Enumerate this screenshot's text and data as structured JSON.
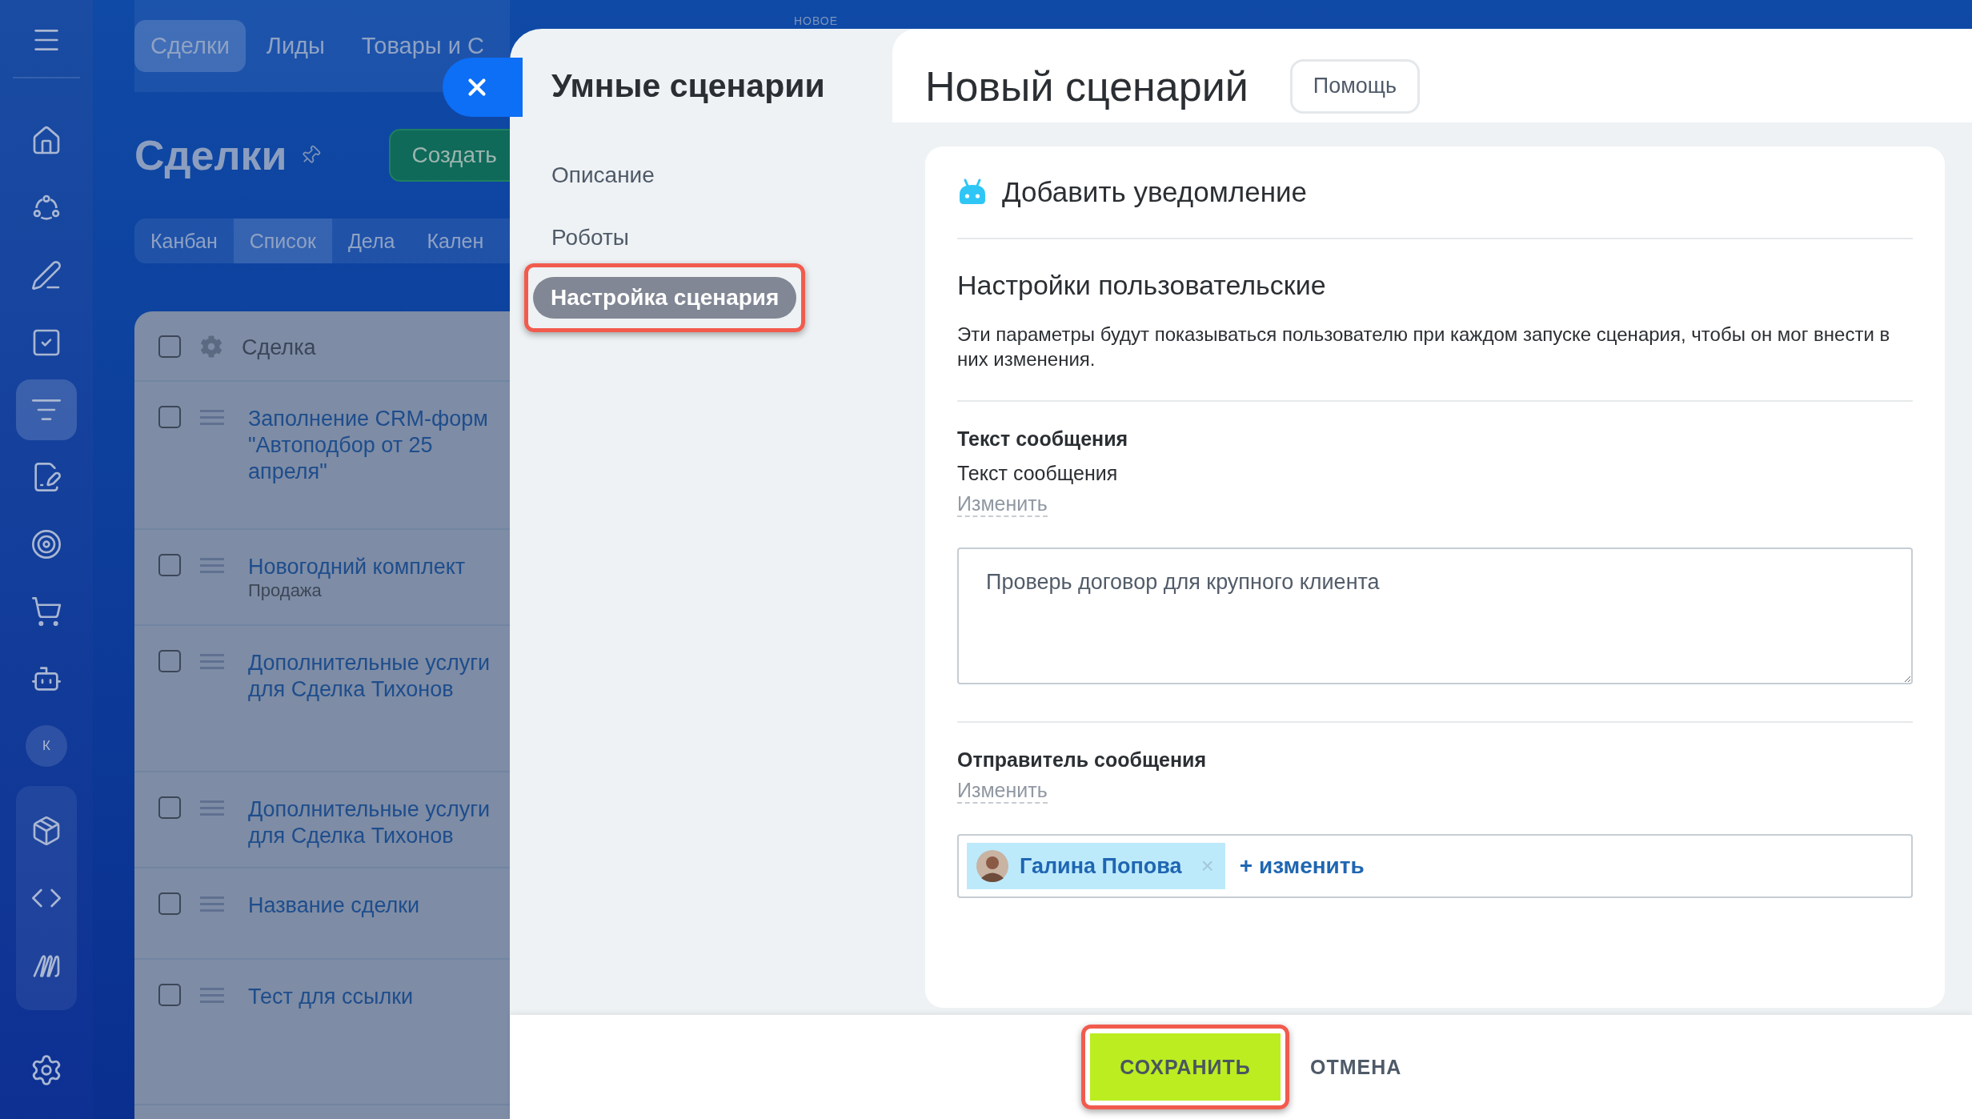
{
  "sidebar": {
    "items": [
      {
        "kind": "icon",
        "selected": false
      },
      {
        "kind": "icon",
        "selected": false
      },
      {
        "kind": "icon",
        "selected": false
      },
      {
        "kind": "icon",
        "selected": false
      },
      {
        "kind": "icon",
        "selected": true
      },
      {
        "kind": "icon",
        "selected": false
      },
      {
        "kind": "icon",
        "selected": false
      },
      {
        "kind": "icon",
        "selected": false
      },
      {
        "kind": "icon",
        "selected": false
      },
      {
        "kind": "avatar",
        "label": "К",
        "selected": false
      }
    ],
    "group_items": [
      {
        "selected": false
      },
      {
        "selected": false
      },
      {
        "selected": false
      }
    ]
  },
  "top_tabs": [
    {
      "label": "Сделки",
      "selected": true
    },
    {
      "label": "Лиды",
      "selected": false
    },
    {
      "label": "Товары и С",
      "selected": false
    }
  ],
  "page_title": "Сделки",
  "create_button": "Создать",
  "view_tabs": [
    {
      "label": "Канбан",
      "selected": false
    },
    {
      "label": "Список",
      "selected": true
    },
    {
      "label": "Дела",
      "selected": false
    },
    {
      "label": "Кален",
      "selected": false
    }
  ],
  "table": {
    "header": {
      "label": "Сделка",
      "checked": false
    },
    "rows": [
      {
        "title": "Заполнение CRM-форм\n\"Автоподбор от 25\nапреля\"",
        "checked": false
      },
      {
        "title": "Новогодний комплект",
        "subtitle": "Продажа",
        "checked": false
      },
      {
        "title": "Дополнительные услуги\nдля Сделка Тихонов",
        "checked": false
      },
      {
        "title": "Дополнительные услуги\nдля Сделка Тихонов",
        "checked": false
      },
      {
        "title": "Название сделки",
        "checked": false
      },
      {
        "title": "Тест для ссылки",
        "checked": false
      }
    ]
  },
  "new_badge": "НОВОЕ",
  "nav": {
    "title": "Умные сценарии",
    "items": [
      {
        "label": "Описание",
        "selected": false
      },
      {
        "label": "Роботы",
        "selected": false
      },
      {
        "label": "Настройка сценария",
        "selected": true
      }
    ]
  },
  "header": {
    "title": "Новый сценарий",
    "help_button": "Помощь"
  },
  "card": {
    "title": "Добавить уведомление",
    "section_title": "Настройки пользовательские",
    "description": "Эти параметры будут показываться пользователю при каждом запуске сценария, чтобы он мог внести в них изменения.",
    "message": {
      "title": "Текст сообщения",
      "label": "Текст сообщения",
      "change_link": "Изменить",
      "value": "Проверь договор для крупного клиента"
    },
    "sender": {
      "title": "Отправитель сообщения",
      "change_link": "Изменить",
      "user": "Галина Попова",
      "remove": "×",
      "add_link": "+ изменить"
    }
  },
  "footer": {
    "save_button": "СОХРАНИТЬ",
    "cancel_button": "ОТМЕНА"
  }
}
